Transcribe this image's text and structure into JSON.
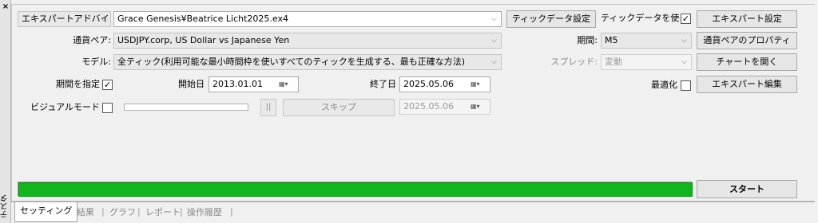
{
  "panel": {
    "title": "テスター",
    "close_glyph": "×"
  },
  "row1": {
    "expert_type": "エキスパートアドバイ",
    "expert_file": "Grace Genesis¥Beatrice Licht2025.ex4",
    "tick_settings_button": "ティックデータ設定",
    "use_tick_data_label": "ティックデータを使う",
    "use_tick_data_checked": true,
    "expert_settings_button": "エキスパート設定"
  },
  "row2": {
    "symbol_label": "通貨ペア:",
    "symbol_value": "USDJPY.corp, US Dollar vs Japanese Yen",
    "period_label": "期間:",
    "period_value": "M5",
    "symbol_properties_button": "通貨ペアのプロパティ"
  },
  "row3": {
    "model_label": "モデル:",
    "model_value": "全ティック(利用可能な最小時間枠を使いすべてのティックを生成する、最も正確な方法)",
    "spread_label": "スプレッド:",
    "spread_value": "変動",
    "open_chart_button": "チャートを開く"
  },
  "row4": {
    "use_date_label": "期間を指定",
    "use_date_checked": true,
    "start_label": "開始日",
    "start_value": "2013.01.01",
    "end_label": "終了日",
    "end_value": "2025.05.06",
    "optimization_label": "最適化",
    "optimization_checked": false,
    "expert_edit_button": "エキスパート編集"
  },
  "row5": {
    "visual_mode_label": "ビジュアルモード",
    "visual_mode_checked": false,
    "pause_glyph": "||",
    "skip_button": "スキップ",
    "skip_date_value": "2025.05.06"
  },
  "progress": {
    "fraction": 1.0,
    "color": "#12b51d"
  },
  "start_button": "スタート",
  "tabs": [
    "セッティング",
    "結果",
    "グラフ",
    "レポート",
    "操作履歴"
  ],
  "icons": {
    "chevron": "chevron-down-icon",
    "calendar": "calendar-icon",
    "check": "checkmark-icon"
  }
}
